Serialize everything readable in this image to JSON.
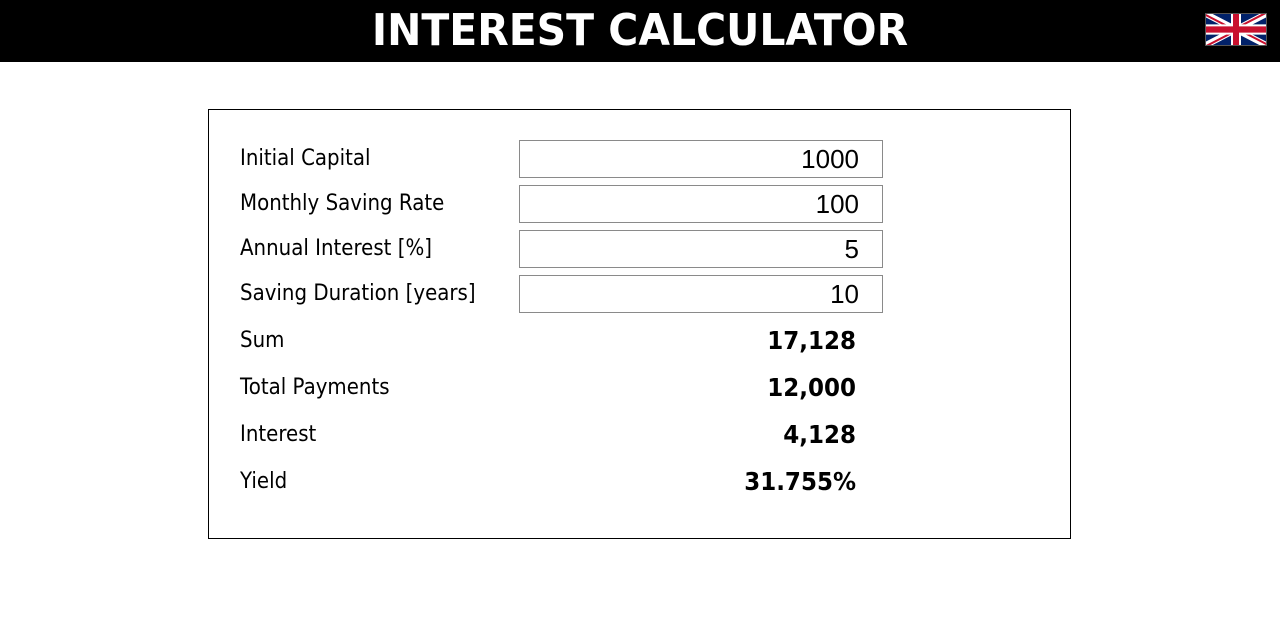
{
  "header": {
    "title": "INTEREST CALCULATOR",
    "language_flag": "uk-flag-icon"
  },
  "inputs": [
    {
      "label": "Initial Capital",
      "value": "1000"
    },
    {
      "label": "Monthly Saving Rate",
      "value": "100"
    },
    {
      "label": "Annual Interest [%]",
      "value": "5"
    },
    {
      "label": "Saving Duration [years]",
      "value": "10"
    }
  ],
  "results": [
    {
      "label": "Sum",
      "value": "17,128"
    },
    {
      "label": "Total Payments",
      "value": "12,000"
    },
    {
      "label": "Interest",
      "value": "4,128"
    },
    {
      "label": "Yield",
      "value": "31.755%"
    }
  ],
  "colors": {
    "header_bg": "#000000",
    "header_text": "#ffffff",
    "flag_blue": "#012169",
    "flag_red": "#C8102E"
  }
}
